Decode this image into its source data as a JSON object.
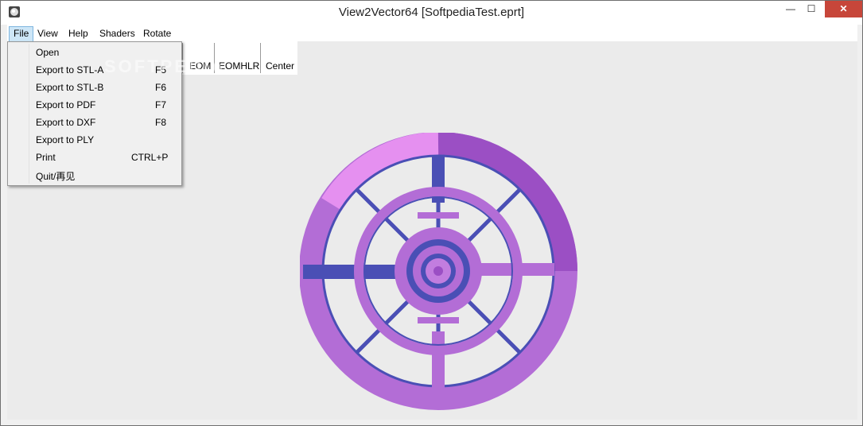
{
  "window": {
    "title": "View2Vector64 [SoftpediaTest.eprt]",
    "minimize_glyph": "—",
    "maximize_glyph": "☐",
    "close_glyph": "✕"
  },
  "menu": {
    "items": [
      {
        "label": "File"
      },
      {
        "label": "View"
      },
      {
        "label": "Help"
      },
      {
        "label": "Shaders"
      },
      {
        "label": "Rotate"
      }
    ]
  },
  "toolbar": {
    "buttons": [
      {
        "label": "EOM"
      },
      {
        "label": "EOMHLR"
      },
      {
        "label": "Center"
      }
    ]
  },
  "file_menu": {
    "items": [
      {
        "label": "Open",
        "shortcut": ""
      },
      {
        "label": "Export to STL-A",
        "shortcut": "F5"
      },
      {
        "label": "Export to STL-B",
        "shortcut": "F6"
      },
      {
        "label": "Export to PDF",
        "shortcut": "F7"
      },
      {
        "label": "Export to DXF",
        "shortcut": "F8"
      },
      {
        "label": "Export to PLY",
        "shortcut": ""
      },
      {
        "label": "Print",
        "shortcut": "CTRL+P"
      },
      {
        "label": "Quit/再见",
        "shortcut": ""
      }
    ]
  },
  "watermark": "SOFTPEDIA",
  "colors": {
    "model_main": "#b068d4",
    "model_light": "#e58ef0",
    "model_dark": "#4a4fb5",
    "canvas_bg": "#ebebeb"
  }
}
